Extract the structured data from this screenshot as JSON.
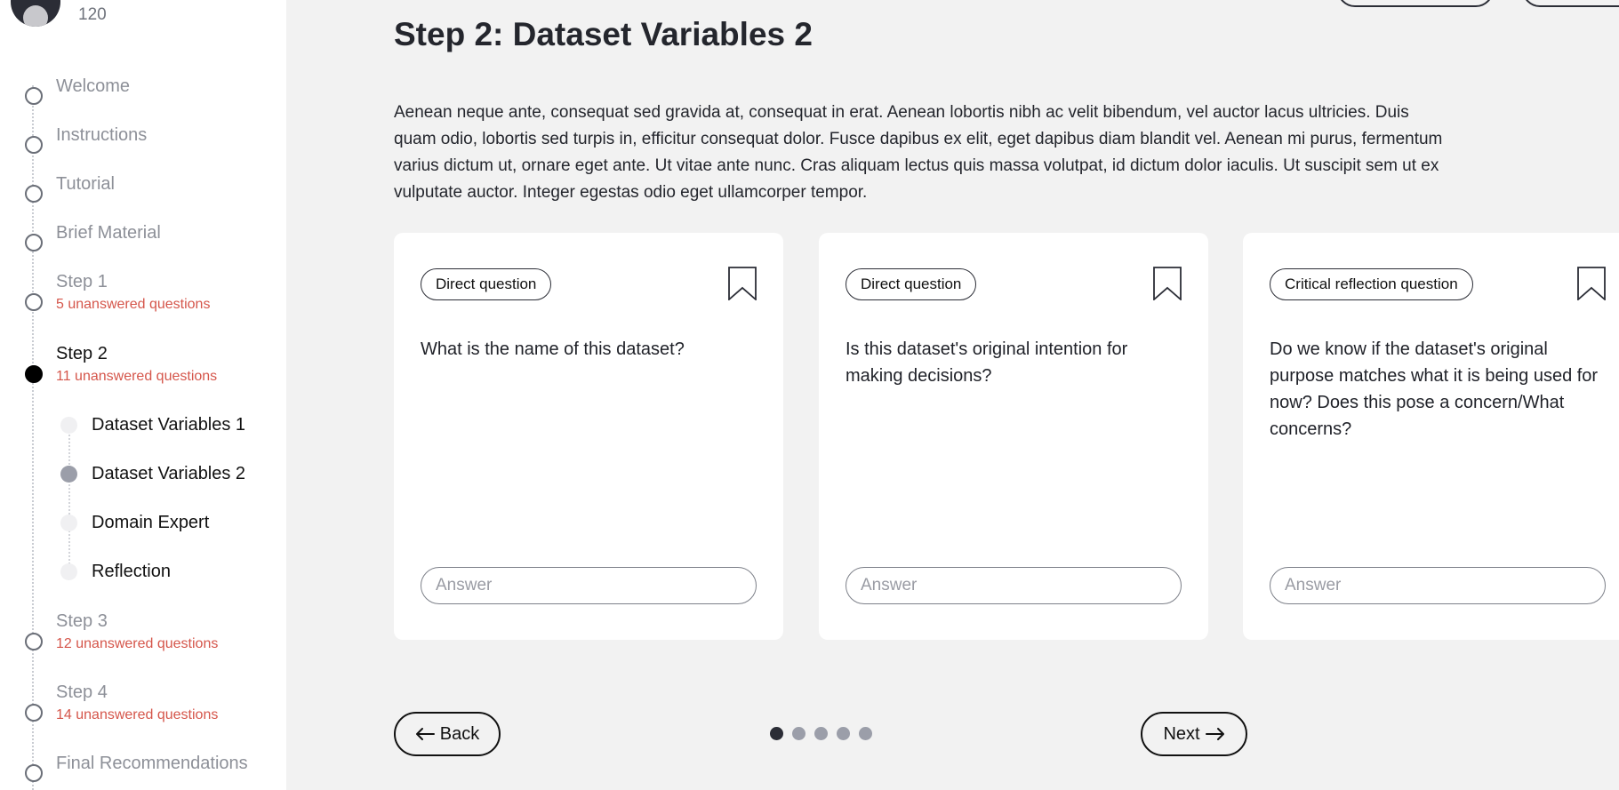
{
  "user": {
    "score": "120"
  },
  "sidebar": {
    "steps": [
      {
        "label": "Welcome",
        "warning": ""
      },
      {
        "label": "Instructions",
        "warning": ""
      },
      {
        "label": "Tutorial",
        "warning": ""
      },
      {
        "label": "Brief Material",
        "warning": ""
      },
      {
        "label": "Step 1",
        "warning": "5 unanswered questions"
      },
      {
        "label": "Step 2",
        "warning": "11 unanswered questions"
      },
      {
        "label": "Step 3",
        "warning": "12 unanswered questions"
      },
      {
        "label": "Step 4",
        "warning": "14 unanswered questions"
      },
      {
        "label": "Final Recommendations",
        "warning": ""
      }
    ],
    "substeps": [
      {
        "label": "Dataset Variables 1"
      },
      {
        "label": "Dataset Variables 2"
      },
      {
        "label": "Domain Expert"
      },
      {
        "label": "Reflection"
      }
    ]
  },
  "main": {
    "title": "Step 2: Dataset Variables 2",
    "intro": "Aenean neque ante, consequat sed gravida at, consequat in erat. Aenean lobortis nibh ac velit bibendum, vel auctor lacus ultricies. Duis quam odio, lobortis sed turpis in, efficitur consequat dolor. Fusce dapibus ex elit, eget dapibus diam blandit vel. Aenean mi purus, fermentum varius dictum ut, ornare eget ante. Ut vitae ante nunc. Cras aliquam lectus quis massa volutpat, id dictum dolor iaculis. Ut suscipit sem ut ex vulputate auctor. Integer egestas odio eget ullamcorper tempor.",
    "cards": [
      {
        "tag": "Direct question",
        "question": "What is the name of this dataset?",
        "answer_placeholder": "Answer"
      },
      {
        "tag": "Direct question",
        "question": "Is this dataset's original intention for making decisions?",
        "answer_placeholder": "Answer"
      },
      {
        "tag": "Critical reflection question",
        "question": "Do we know if the dataset's original purpose matches what it is being used for now? Does this pose a concern/What concerns?",
        "answer_placeholder": "Answer"
      }
    ]
  },
  "navigation": {
    "back_label": "Back",
    "next_label": "Next"
  },
  "pagination": {
    "total": 5,
    "current": 1
  },
  "colors": {
    "warning": "#d5564b",
    "active": "#000000",
    "background": "#f2f2f2"
  },
  "icons": {
    "bookmark": "bookmark-icon",
    "back": "arrow-left-icon",
    "next": "arrow-right-icon"
  }
}
